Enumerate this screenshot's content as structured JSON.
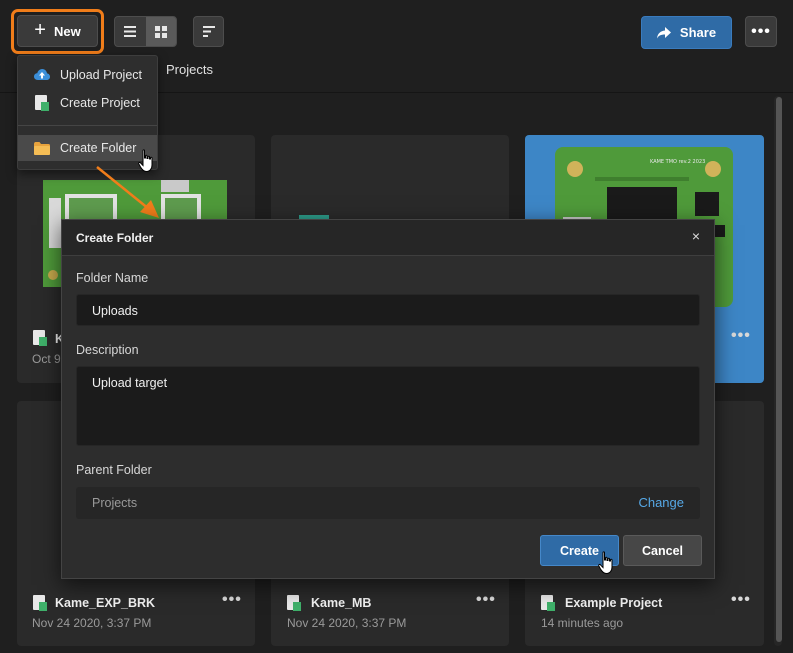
{
  "toolbar": {
    "new_label": "New",
    "share_label": "Share",
    "more_label": "•••"
  },
  "breadcrumb": {
    "current": "Projects"
  },
  "new_menu": {
    "items": [
      {
        "label": "Upload Project",
        "icon": "cloud-upload-icon"
      },
      {
        "label": "Create Project",
        "icon": "project-file-icon"
      },
      {
        "label": "Create Folder",
        "icon": "folder-icon",
        "hovered": true
      }
    ]
  },
  "background_cards": {
    "top_left_partial": {
      "title_fragment": "K",
      "date_fragment": "Oct 9"
    },
    "top_right_board_text": "KAME TMO rev.2 2023",
    "bottom": [
      {
        "title": "Kame_EXP_BRK",
        "date": "Nov 24 2020, 3:37 PM"
      },
      {
        "title": "Kame_MB",
        "date": "Nov 24 2020, 3:37 PM"
      },
      {
        "title": "Example Project",
        "date": "14 minutes ago"
      }
    ]
  },
  "dialog": {
    "title": "Create Folder",
    "close_label": "×",
    "folder_name_label": "Folder Name",
    "folder_name_value": "Uploads",
    "description_label": "Description",
    "description_value": "Upload target",
    "parent_folder_label": "Parent Folder",
    "parent_folder_value": "Projects",
    "change_label": "Change",
    "create_label": "Create",
    "cancel_label": "Cancel"
  },
  "colors": {
    "accent_orange": "#f07d1a",
    "primary_blue": "#2f6ba6",
    "link_blue": "#56a8e6",
    "pcb_green": "#4f9a3a",
    "card_blue": "#3d86c6"
  }
}
